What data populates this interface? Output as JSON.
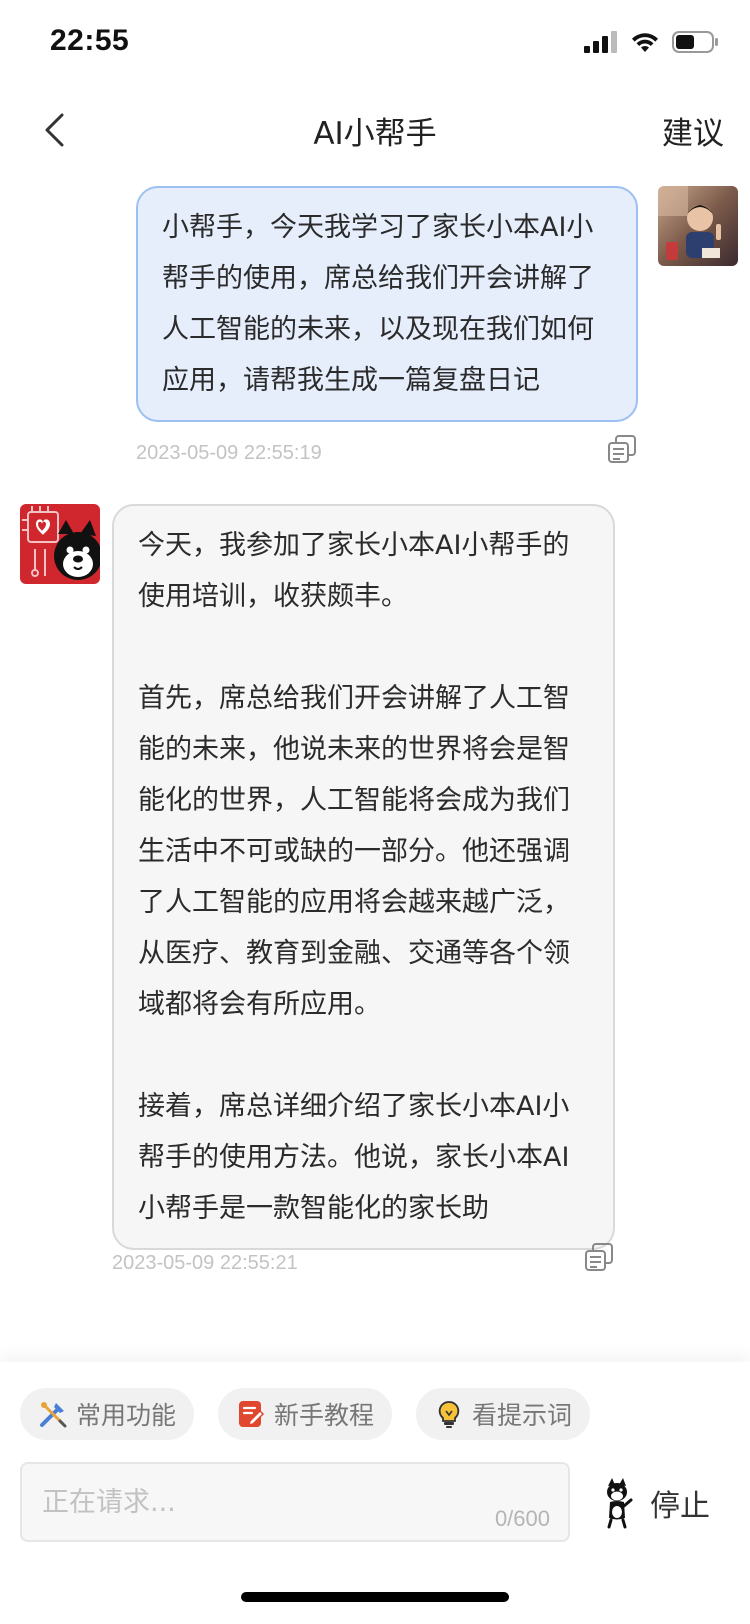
{
  "status_bar": {
    "time": "22:55",
    "icons": [
      "signal-icon",
      "wifi-icon",
      "battery-icon"
    ]
  },
  "nav": {
    "back_icon": "chevron-left-icon",
    "title": "AI小帮手",
    "action": "建议"
  },
  "messages": [
    {
      "role": "user",
      "text": "小帮手，今天我学习了家长小本AI小帮手的使用，席总给我们开会讲解了人工智能的未来，以及现在我们如何应用，请帮我生成一篇复盘日记",
      "timestamp": "2023-05-09 22:55:19"
    },
    {
      "role": "assistant",
      "text": "今天，我参加了家长小本AI小帮手的使用培训，收获颇丰。\n\n首先，席总给我们开会讲解了人工智能的未来，他说未来的世界将会是智能化的世界，人工智能将会成为我们生活中不可或缺的一部分。他还强调了人工智能的应用将会越来越广泛，从医疗、教育到金融、交通等各个领域都将会有所应用。\n\n接着，席总详细介绍了家长小本AI小帮手的使用方法。他说，家长小本AI小帮手是一款智能化的家长助",
      "timestamp": "2023-05-09 22:55:21"
    }
  ],
  "quick_actions": [
    {
      "label": "常用功能",
      "icon": "tools-icon"
    },
    {
      "label": "新手教程",
      "icon": "tutorial-icon"
    },
    {
      "label": "看提示词",
      "icon": "lightbulb-icon"
    }
  ],
  "input": {
    "placeholder": "正在请求...",
    "value": "",
    "counter": "0/600"
  },
  "stop_button": {
    "label": "停止",
    "icon": "dog-mascot-icon"
  },
  "colors": {
    "user_bubble_bg": "#e6eefc",
    "user_bubble_border": "#9dc0f3",
    "bot_bubble_bg": "#f6f6f6",
    "bot_avatar_bg": "#d0262e"
  }
}
